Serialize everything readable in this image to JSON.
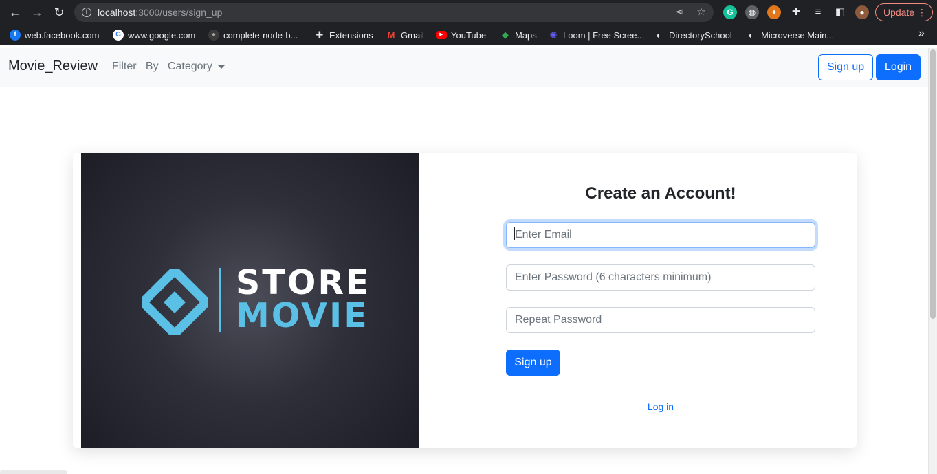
{
  "browser": {
    "url_host": "localhost",
    "url_rest": ":3000/users/sign_up",
    "update_label": "Update",
    "bookmarks": [
      {
        "label": "web.facebook.com",
        "color": "#1877f2",
        "glyph": "f"
      },
      {
        "label": "www.google.com",
        "color": "#ffffff",
        "glyph": "G"
      },
      {
        "label": "complete-node-b...",
        "color": "#3a3a3a",
        "glyph": ""
      },
      {
        "label": "Extensions",
        "color": "",
        "glyph": "✚"
      },
      {
        "label": "Gmail",
        "color": "",
        "glyph": "M"
      },
      {
        "label": "YouTube",
        "color": "#ff0000",
        "glyph": "▶"
      },
      {
        "label": "Maps",
        "color": "",
        "glyph": "◆"
      },
      {
        "label": "Loom | Free Scree...",
        "color": "",
        "glyph": "✺"
      },
      {
        "label": "DirectorySchool",
        "color": "",
        "glyph": "◐"
      },
      {
        "label": "Microverse Main...",
        "color": "",
        "glyph": "◐"
      }
    ]
  },
  "navbar": {
    "brand": "Movie_Review",
    "filter": "Filter _By_ Category",
    "signup": "Sign up",
    "login": "Login"
  },
  "hero": {
    "logo_top": "STORE",
    "logo_bottom": "MOVIE"
  },
  "form": {
    "title": "Create an Account!",
    "email_placeholder": "Enter Email",
    "password_placeholder": "Enter Password (6 characters minimum)",
    "repeat_placeholder": "Repeat Password",
    "submit": "Sign up",
    "login_link": "Log in"
  },
  "colors": {
    "primary": "#0d6efd",
    "logo_accent": "#5bc0e5",
    "hero_bg": "#2e2f39"
  }
}
